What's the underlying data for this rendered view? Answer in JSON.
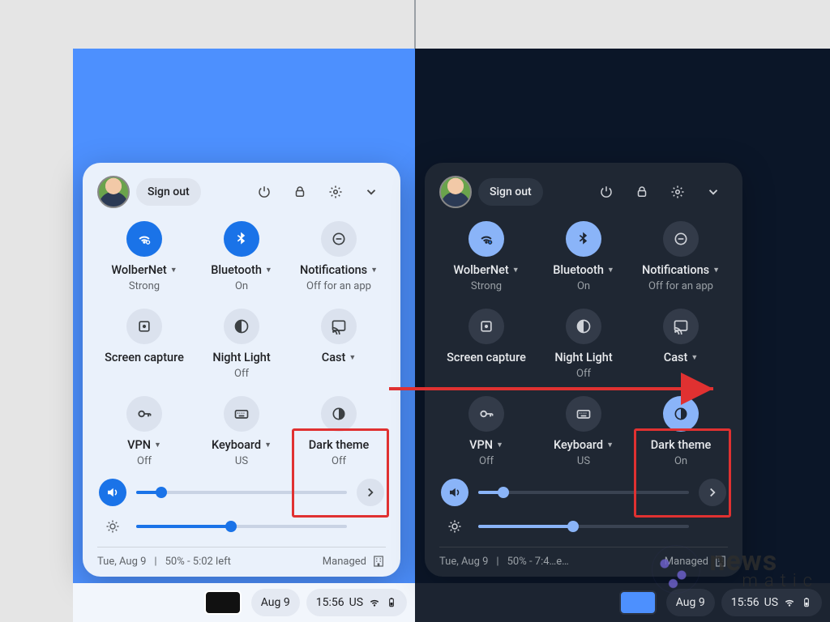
{
  "header": {
    "sign_out": "Sign out"
  },
  "tiles_light": {
    "wifi": {
      "label": "WolberNet",
      "sub": "Strong",
      "caret": true,
      "on": true
    },
    "bluetooth": {
      "label": "Bluetooth",
      "sub": "On",
      "caret": true,
      "on": true
    },
    "notif": {
      "label": "Notifications",
      "sub": "Off for an app",
      "caret": true,
      "on": false
    },
    "capture": {
      "label": "Screen capture",
      "sub": "",
      "caret": false,
      "on": false
    },
    "nightlight": {
      "label": "Night Light",
      "sub": "Off",
      "caret": false,
      "on": false
    },
    "cast": {
      "label": "Cast",
      "sub": "",
      "caret": true,
      "on": false
    },
    "vpn": {
      "label": "VPN",
      "sub": "Off",
      "caret": true,
      "on": false
    },
    "keyboard": {
      "label": "Keyboard",
      "sub": "US",
      "caret": true,
      "on": false
    },
    "darktheme": {
      "label": "Dark theme",
      "sub": "Off",
      "caret": false,
      "on": false
    }
  },
  "tiles_dark": {
    "wifi": {
      "label": "WolberNet",
      "sub": "Strong",
      "caret": true,
      "on": true
    },
    "bluetooth": {
      "label": "Bluetooth",
      "sub": "On",
      "caret": true,
      "on": true
    },
    "notif": {
      "label": "Notifications",
      "sub": "Off for an app",
      "caret": true,
      "on": false
    },
    "capture": {
      "label": "Screen capture",
      "sub": "",
      "caret": false,
      "on": false
    },
    "nightlight": {
      "label": "Night Light",
      "sub": "Off",
      "caret": false,
      "on": false
    },
    "cast": {
      "label": "Cast",
      "sub": "",
      "caret": true,
      "on": false
    },
    "vpn": {
      "label": "VPN",
      "sub": "Off",
      "caret": true,
      "on": false
    },
    "keyboard": {
      "label": "Keyboard",
      "sub": "US",
      "caret": true,
      "on": false
    },
    "darktheme": {
      "label": "Dark theme",
      "sub": "On",
      "caret": false,
      "on": true
    }
  },
  "sliders": {
    "volume_pct": 12,
    "brightness_pct": 45
  },
  "footer_light": {
    "date": "Tue, Aug 9",
    "battery": "50% - 5:02 left",
    "managed": "Managed"
  },
  "footer_dark": {
    "date": "Tue, Aug 9",
    "battery": "50% - 7:4…e…",
    "managed": "Managed"
  },
  "shelf": {
    "date": "Aug 9",
    "clock": "15:56",
    "ime": "US"
  },
  "watermark": {
    "line1": "news",
    "line2": "matic"
  }
}
